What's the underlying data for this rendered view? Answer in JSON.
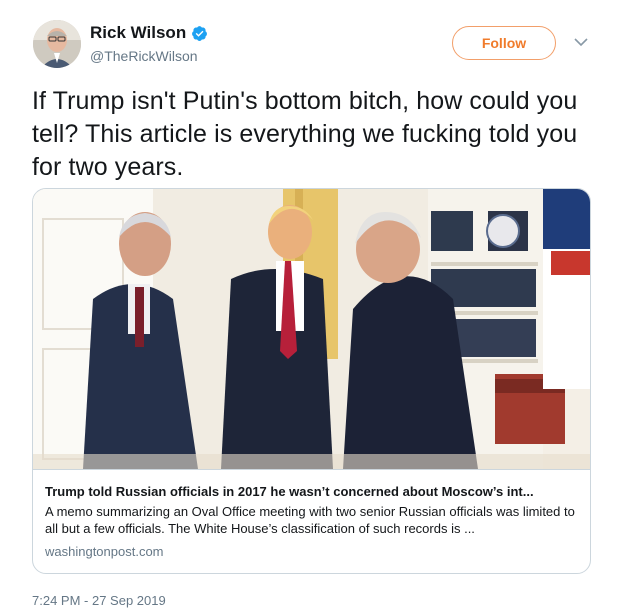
{
  "author": {
    "name": "Rick Wilson",
    "handle": "@TheRickWilson",
    "verified": true
  },
  "follow_button": {
    "label": "Follow"
  },
  "tweet": {
    "text": "If Trump isn't Putin's bottom bitch, how could you tell? This article is everything we fucking told you for two years."
  },
  "card": {
    "title": "Trump told Russian officials in 2017 he wasn’t concerned about Moscow’s int...",
    "description": "A memo summarizing an Oval Office meeting with two senior Russian officials was limited to all but a few officials. The White House’s classification of such records is ...",
    "domain": "washingtonpost.com"
  },
  "timestamp": "7:24 PM - 27 Sep 2019",
  "colors": {
    "follow_accent": "#f07b2b",
    "verified_badge": "#1da1f2",
    "secondary_text": "#657786"
  },
  "icons": [
    "verified-badge-icon",
    "chevron-down-icon"
  ]
}
